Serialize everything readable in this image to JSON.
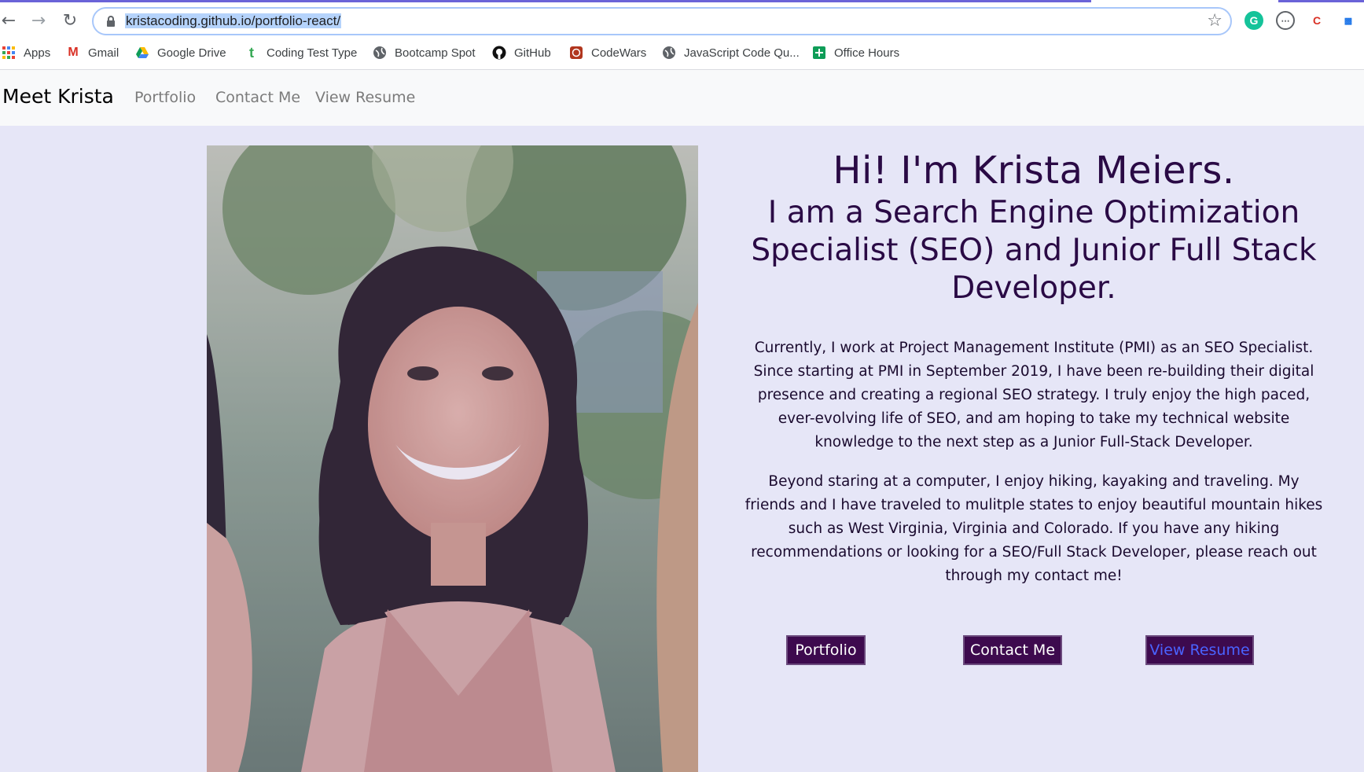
{
  "browser": {
    "url_text": "kristacoding.github.io/portfolio-react/",
    "bookmarks": [
      {
        "label": "Apps",
        "icon": "apps-grid-icon",
        "color": "#4285f4"
      },
      {
        "label": "Gmail",
        "icon": "gmail-icon",
        "color": "#d93025"
      },
      {
        "label": "Google Drive",
        "icon": "google-drive-icon",
        "color": "#0f9d58"
      },
      {
        "label": "Coding Test Type",
        "icon": "t-icon",
        "color": "#34a853"
      },
      {
        "label": "Bootcamp Spot",
        "icon": "globe-icon",
        "color": "#5f6368"
      },
      {
        "label": "GitHub",
        "icon": "github-icon",
        "color": "#000000"
      },
      {
        "label": "CodeWars",
        "icon": "codewars-icon",
        "color": "#b1361e"
      },
      {
        "label": "JavaScript Code Qu...",
        "icon": "globe-icon",
        "color": "#5f6368"
      },
      {
        "label": "Office Hours",
        "icon": "plus-square-icon",
        "color": "#0f9d58"
      }
    ]
  },
  "site": {
    "brand": "Meet Krista",
    "nav": [
      "Portfolio",
      "Contact Me",
      "View Resume"
    ],
    "heading": "Hi! I'm Krista Meiers.",
    "subheading": "I am a Search Engine Optimization Specialist (SEO) and Junior Full Stack Developer.",
    "paragraph1": "Currently, I work at Project Management Institute (PMI) as an SEO Specialist. Since starting at PMI in September 2019, I have been re-building their digital presence and creating a regional SEO strategy. I truly enjoy the high paced, ever-evolving life of SEO, and am hoping to take my technical website knowledge to the next step as a Junior Full-Stack Developer.",
    "paragraph2": "Beyond staring at a computer, I enjoy hiking, kayaking and traveling. My friends and I have traveled to mulitple states to enjoy beautiful mountain hikes such as West Virginia, Virginia and Colorado. If you have any hiking recommendations or looking for a SEO/Full Stack Developer, please reach out through my contact me!",
    "buttons": [
      "Portfolio",
      "Contact Me",
      "View Resume"
    ]
  },
  "colors": {
    "page_background": "#e6e6f7",
    "heading_text": "#2a0a45",
    "button_background": "#3d0a4e",
    "resume_link": "#4a63ff"
  }
}
